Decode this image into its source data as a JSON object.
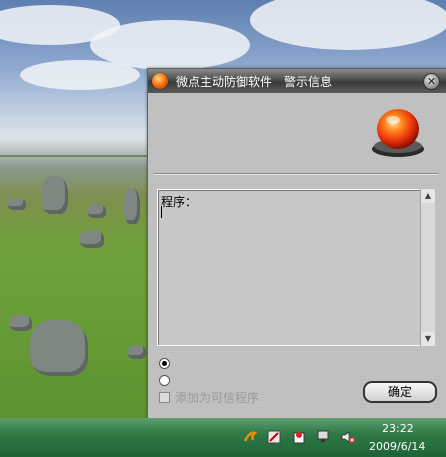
{
  "dialog": {
    "title": "微点主动防御软件　警示信息",
    "close_glyph": "✕",
    "info_label": "程序：",
    "radio_1_label": "",
    "radio_2_label": "",
    "checkbox_label": "添加为可信程序",
    "ok_button": "确定"
  },
  "scrollbar": {
    "up_glyph": "▲",
    "down_glyph": "▼"
  },
  "taskbar": {
    "time": "23:22",
    "date": "2009/6/14",
    "tray_icons": [
      "swirl-app-icon",
      "safely-remove-icon",
      "security-app-icon",
      "network-icon",
      "volume-muted-icon"
    ]
  },
  "colors": {
    "alarm_red": "#e8300a",
    "taskbar_green": "#2f7a47"
  }
}
